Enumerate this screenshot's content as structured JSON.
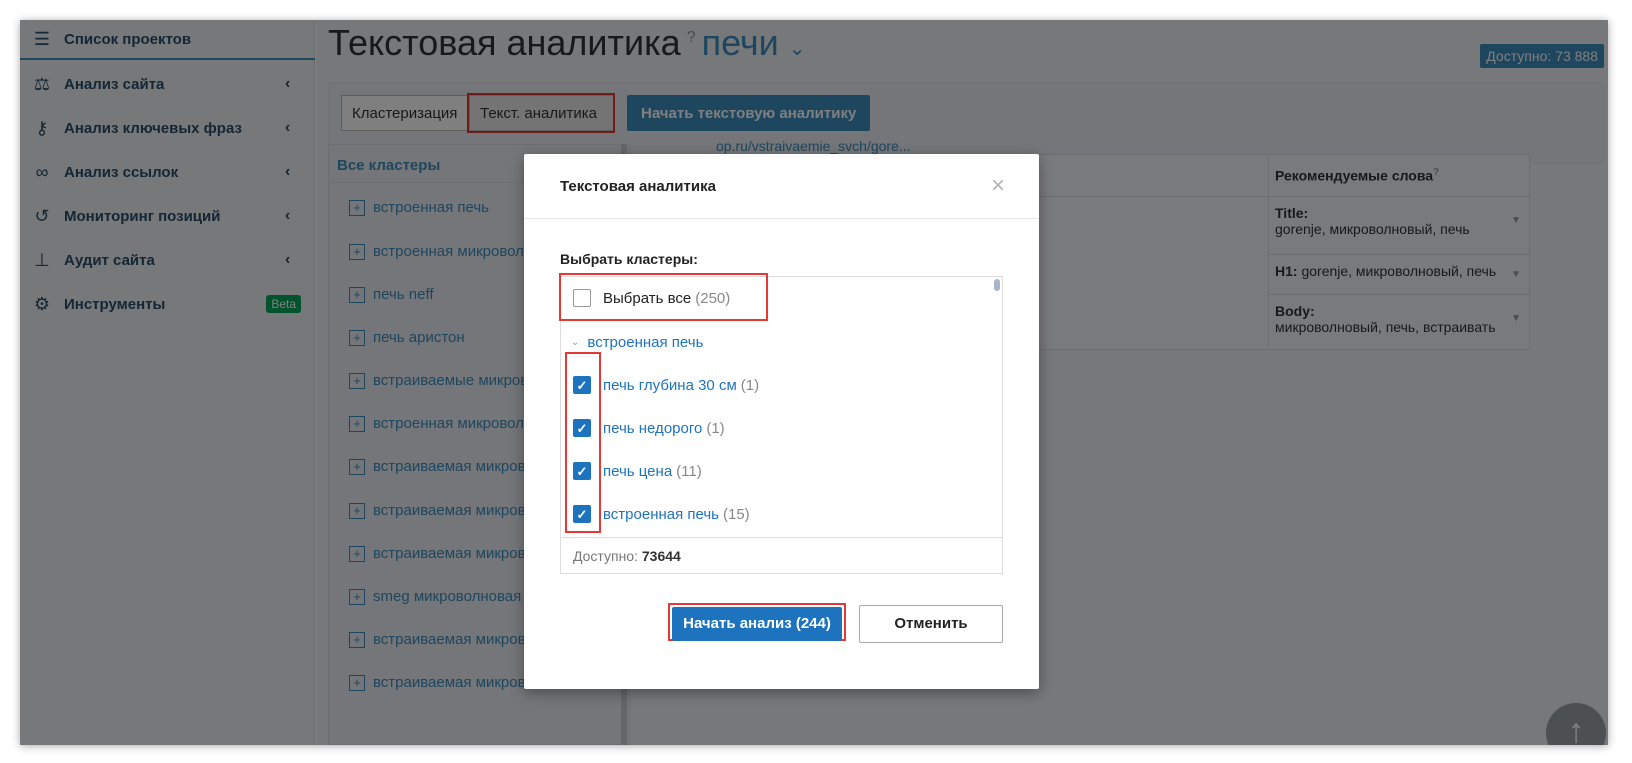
{
  "sidebar": {
    "items": [
      {
        "label": "Список проектов",
        "icon": "menu-icon"
      },
      {
        "label": "Анализ сайта",
        "icon": "site-analysis-icon"
      },
      {
        "label": "Анализ ключевых фраз",
        "icon": "key-icon"
      },
      {
        "label": "Анализ ссылок",
        "icon": "link-icon"
      },
      {
        "label": "Мониторинг позиций",
        "icon": "history-icon"
      },
      {
        "label": "Аудит сайта",
        "icon": "sitemap-icon"
      },
      {
        "label": "Инструменты",
        "icon": "gear-icon",
        "badge": "Beta"
      }
    ]
  },
  "header": {
    "title": "Текстовая аналитика",
    "help": "?",
    "project": "печи",
    "available": "Доступно: 73 888"
  },
  "toolbar": {
    "tab_clusterization": "Кластеризация",
    "tab_text_analytics": "Текст. аналитика",
    "start_button": "Начать текстовую аналитику"
  },
  "clusters": {
    "header": "Все кластеры",
    "items": [
      "встроенная печь",
      "встроенная микроволновая печь",
      "печь neff",
      "печь аристон",
      "встраиваемые микроволновые печи",
      "встроенная микроволновая печь",
      "встраиваемая микроволновая печь",
      "встраиваемая микроволновая печь",
      "встраиваемая микроволновая печь",
      "smeg микроволновая печь",
      "встраиваемая микроволновая печь",
      "встраиваемая микроволновая печь"
    ]
  },
  "table": {
    "url": "op.ru/vstraivaemie_svch/gore...",
    "recommended_header": "Рекомендуемые слова",
    "recommended": [
      {
        "key": "Title:",
        "value": "gorenje, микроволновый, печь"
      },
      {
        "key": "H1:",
        "value": "gorenje, микроволновый, печь"
      },
      {
        "key": "Body:",
        "value": "микроволновый, печь, встраивать"
      }
    ]
  },
  "modal": {
    "title": "Текстовая аналитика",
    "close": "×",
    "choose_label": "Выбрать кластеры:",
    "select_all": {
      "label": "Выбрать все",
      "count": "(250)",
      "checked": false
    },
    "group": "встроенная печь",
    "items": [
      {
        "label": "печь глубина 30 см",
        "count": "(1)",
        "checked": true
      },
      {
        "label": "печь недорого",
        "count": "(1)",
        "checked": true
      },
      {
        "label": "печь цена",
        "count": "(11)",
        "checked": true
      },
      {
        "label": "встроенная печь",
        "count": "(15)",
        "checked": true
      }
    ],
    "footer_label": "Доступно:",
    "footer_value": "73644",
    "start": "Начать анализ (244)",
    "cancel": "Отменить"
  },
  "colors": {
    "accent": "#3c8dbc",
    "primary": "#1e73be",
    "highlight": "#e53935"
  }
}
